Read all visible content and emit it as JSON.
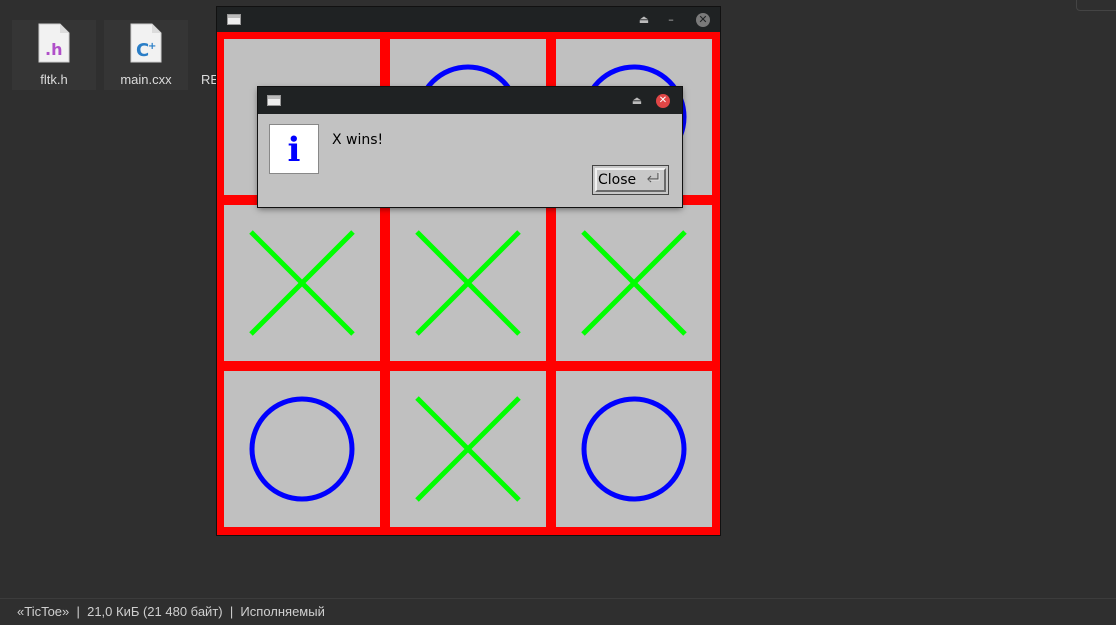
{
  "files": [
    {
      "name": "fltk.h",
      "icon": "c-header-file-icon"
    },
    {
      "name": "main.cxx",
      "icon": "cpp-source-file-icon"
    }
  ],
  "partial_file_label": "RE",
  "statusbar": {
    "text": "«TicToe»  |  21,0 КиБ (21 480 байт)  |  Исполняемый"
  },
  "game_window": {
    "title_icon": "app-window-icon",
    "board": [
      [
        "",
        "O",
        "O"
      ],
      [
        "X",
        "X",
        "X"
      ],
      [
        "O",
        "X",
        "O"
      ]
    ],
    "colors": {
      "grid": "#ff0000",
      "cell": "#c0c0c0",
      "x": "#00ff00",
      "o": "#0000ff"
    }
  },
  "dialog": {
    "icon_glyph": "i",
    "message": "X wins!",
    "button_label": "Close"
  }
}
